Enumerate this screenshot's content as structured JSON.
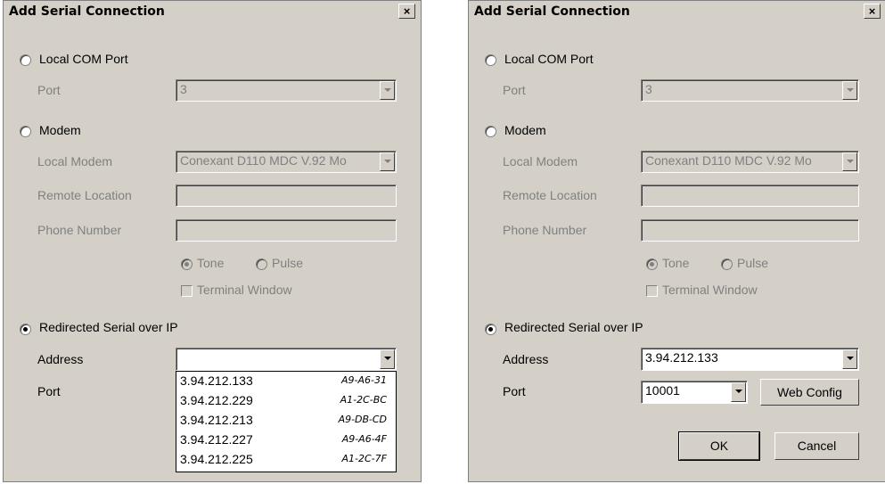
{
  "dialogs": [
    {
      "title": "Add Serial Connection",
      "close_label": "×",
      "local_com": {
        "label": "Local COM Port",
        "port_label": "Port",
        "port_value": "3"
      },
      "modem": {
        "label": "Modem",
        "local_modem_label": "Local Modem",
        "local_modem_value": "Conexant D110 MDC V.92 Mo",
        "remote_location_label": "Remote Location",
        "phone_number_label": "Phone Number",
        "tone_label": "Tone",
        "pulse_label": "Pulse",
        "terminal_label": "Terminal Window"
      },
      "redirected": {
        "label": "Redirected Serial over IP",
        "address_label": "Address",
        "address_value": "",
        "port_label": "Port"
      },
      "address_dropdown": [
        {
          "ip": "3.94.212.133",
          "mac": "A9-A6-31"
        },
        {
          "ip": "3.94.212.229",
          "mac": "A1-2C-BC"
        },
        {
          "ip": "3.94.212.213",
          "mac": "A9-DB-CD"
        },
        {
          "ip": "3.94.212.227",
          "mac": "A9-A6-4F"
        },
        {
          "ip": "3.94.212.225",
          "mac": "A1-2C-7F"
        }
      ]
    },
    {
      "title": "Add Serial Connection",
      "close_label": "×",
      "local_com": {
        "label": "Local COM Port",
        "port_label": "Port",
        "port_value": "3"
      },
      "modem": {
        "label": "Modem",
        "local_modem_label": "Local Modem",
        "local_modem_value": "Conexant D110 MDC V.92 Mo",
        "remote_location_label": "Remote Location",
        "phone_number_label": "Phone Number",
        "tone_label": "Tone",
        "pulse_label": "Pulse",
        "terminal_label": "Terminal Window"
      },
      "redirected": {
        "label": "Redirected Serial over IP",
        "address_label": "Address",
        "address_value": "3.94.212.133",
        "port_label": "Port",
        "port_value": "10001",
        "web_config_label": "Web Config"
      },
      "ok_label": "OK",
      "cancel_label": "Cancel"
    }
  ]
}
